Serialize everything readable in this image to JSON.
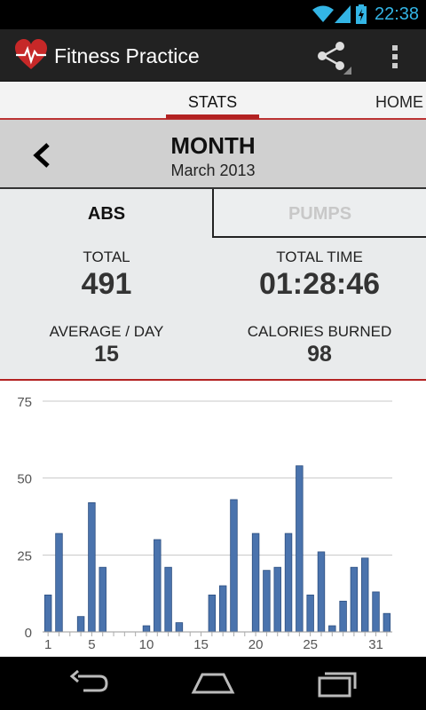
{
  "status_bar": {
    "time": "22:38"
  },
  "action_bar": {
    "title": "Fitness Practice"
  },
  "tabs": [
    {
      "label": "STATS",
      "selected": true
    },
    {
      "label": "HOME",
      "selected": false
    }
  ],
  "period": {
    "title": "MONTH",
    "subtitle": "March 2013"
  },
  "exercise_tabs": [
    {
      "label": "ABS",
      "selected": true
    },
    {
      "label": "PUMPS",
      "selected": false
    }
  ],
  "stats": {
    "total": {
      "label": "TOTAL",
      "value": "491"
    },
    "total_time": {
      "label": "TOTAL TIME",
      "value": "01:28:46"
    },
    "average": {
      "label": "AVERAGE / DAY",
      "value": "15"
    },
    "calories": {
      "label": "CALORIES BURNED",
      "value": "98"
    }
  },
  "colors": {
    "accent": "#b32222",
    "bar": "#4a73ad",
    "status_time": "#33b5e5"
  },
  "chart_data": {
    "type": "bar",
    "categories": [
      1,
      2,
      3,
      4,
      5,
      6,
      7,
      8,
      9,
      10,
      11,
      12,
      13,
      14,
      15,
      16,
      17,
      18,
      19,
      20,
      21,
      22,
      23,
      24,
      25,
      26,
      27,
      28,
      29,
      30,
      31
    ],
    "values": [
      12,
      32,
      0,
      5,
      42,
      21,
      0,
      0,
      0,
      2,
      30,
      21,
      3,
      0,
      0,
      12,
      15,
      43,
      0,
      0,
      32,
      20,
      21,
      32,
      54,
      12,
      26,
      2,
      10,
      21,
      24,
      13,
      6
    ],
    "series": [
      {
        "values": [
          12,
          32,
          0,
          5,
          42,
          21,
          0,
          0,
          0,
          2,
          30,
          21,
          3,
          0,
          0,
          12,
          15,
          43,
          0,
          32,
          20,
          21,
          32,
          54,
          12,
          26,
          2,
          10,
          21,
          24,
          13,
          6
        ]
      }
    ],
    "xticks": [
      1,
      5,
      10,
      15,
      20,
      25,
      31
    ],
    "yticks": [
      0,
      25,
      50,
      75
    ],
    "ylim": [
      0,
      75
    ],
    "grid": true
  }
}
